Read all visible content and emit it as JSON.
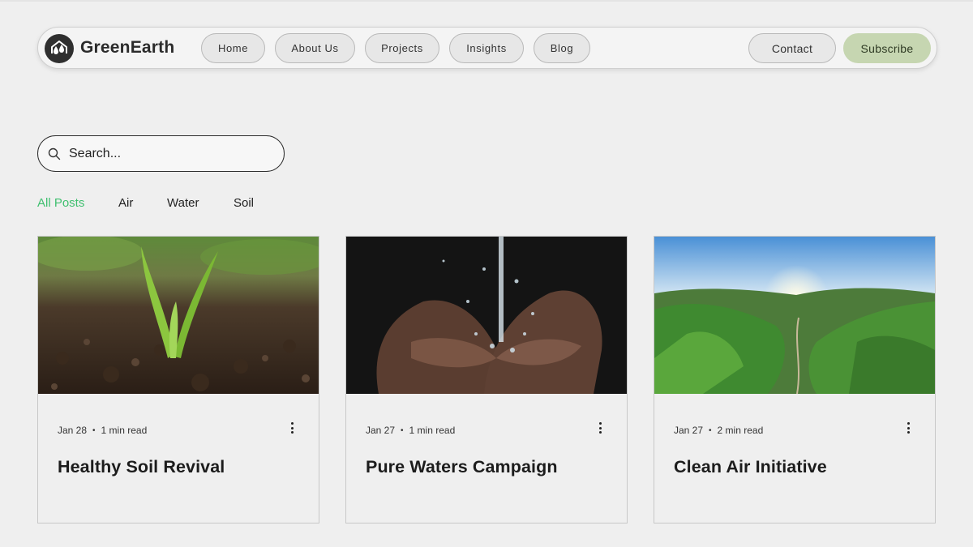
{
  "header": {
    "brand": "GreenEarth",
    "nav": [
      {
        "label": "Home"
      },
      {
        "label": "About Us"
      },
      {
        "label": "Projects"
      },
      {
        "label": "Insights"
      },
      {
        "label": "Blog"
      }
    ],
    "contact_label": "Contact",
    "subscribe_label": "Subscribe"
  },
  "search": {
    "placeholder": "Search..."
  },
  "categories": [
    {
      "label": "All Posts",
      "active": true
    },
    {
      "label": "Air"
    },
    {
      "label": "Water"
    },
    {
      "label": "Soil"
    }
  ],
  "posts": [
    {
      "date": "Jan 28",
      "read_time": "1 min read",
      "title": "Healthy Soil Revival",
      "image": "seedling-in-soil-photo"
    },
    {
      "date": "Jan 27",
      "read_time": "1 min read",
      "title": "Pure Waters Campaign",
      "image": "hands-catching-water-photo"
    },
    {
      "date": "Jan 27",
      "read_time": "2 min read",
      "title": "Clean Air Initiative",
      "image": "green-valley-sunrise-photo"
    }
  ],
  "colors": {
    "accent_active": "#3fbf6f",
    "subscribe_bg": "#c6d6b1",
    "page_bg": "#efefef"
  }
}
